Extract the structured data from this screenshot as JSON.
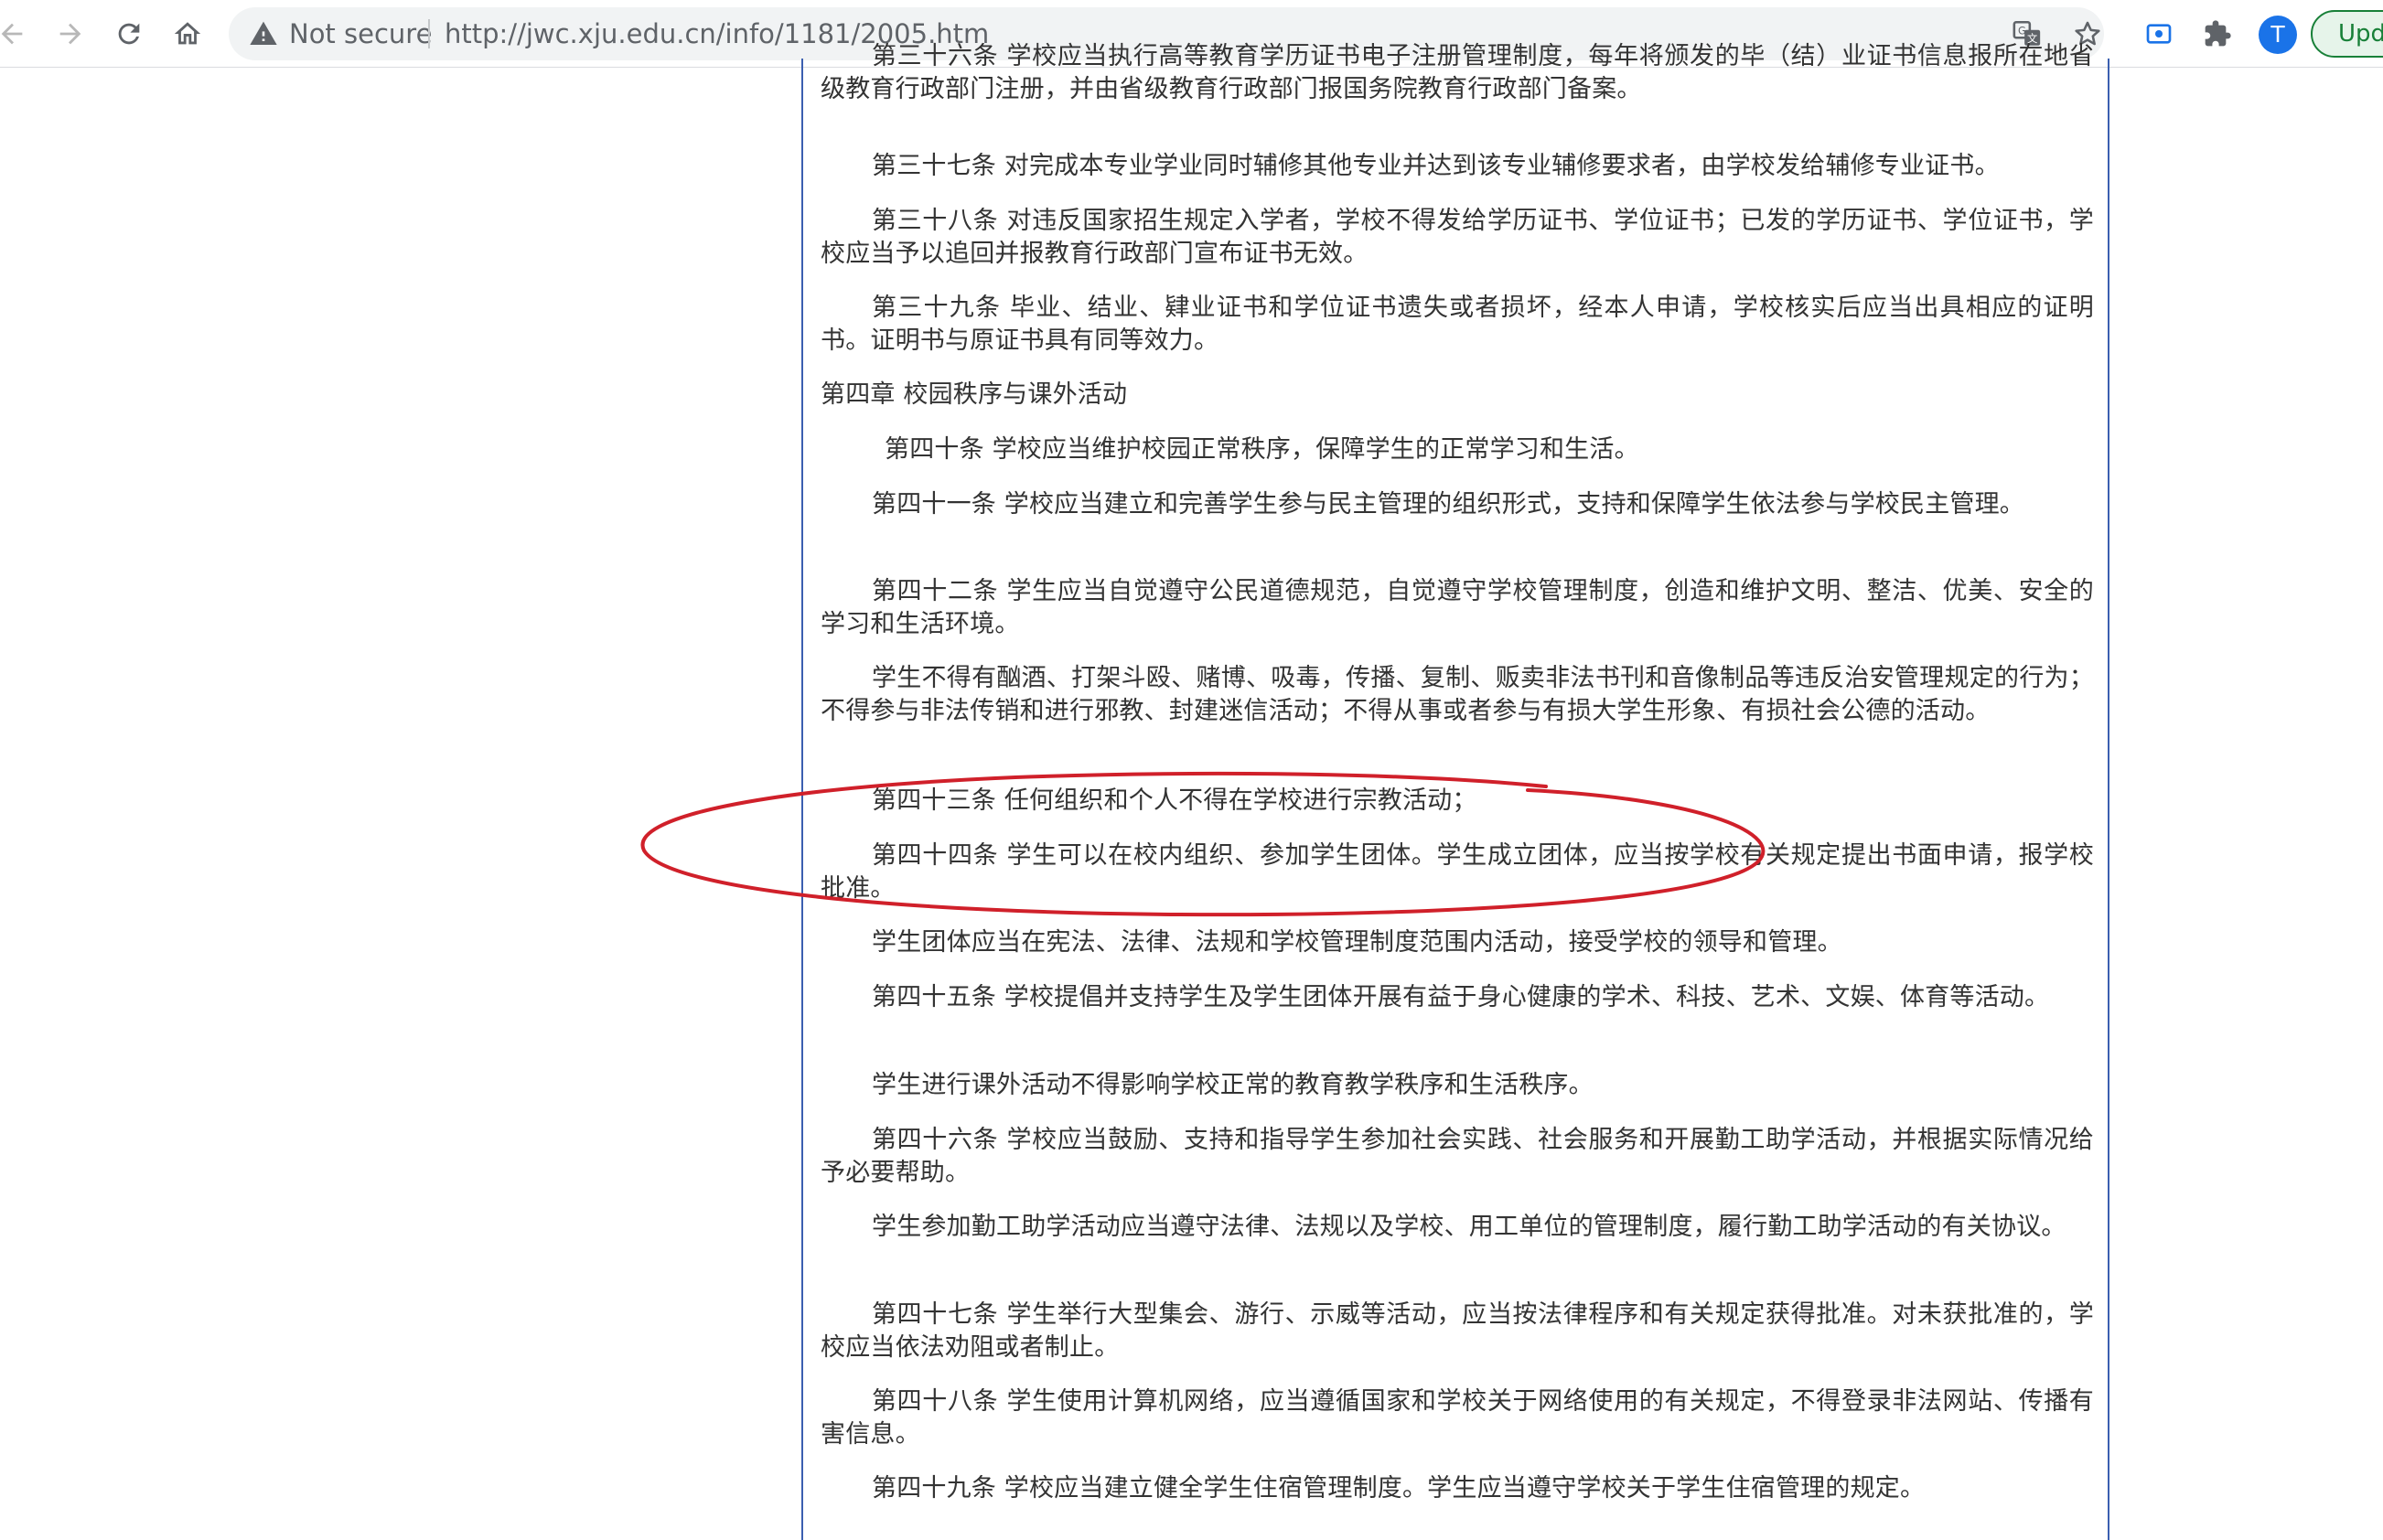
{
  "browser": {
    "security_label": "Not secure",
    "url": "http://jwc.xju.edu.cn/info/1181/2005.htm",
    "avatar_letter": "T",
    "update_label": "Upda"
  },
  "article": {
    "paragraphs": [
      "第三十六条 学校应当执行高等教育学历证书电子注册管理制度，每年将颁发的毕（结）业证书信息报所在地省级教育行政部门注册，并由省级教育行政部门报国务院教育行政部门备案。",
      "第三十七条 对完成本专业学业同时辅修其他专业并达到该专业辅修要求者，由学校发给辅修专业证书。",
      "第三十八条 对违反国家招生规定入学者，学校不得发给学历证书、学位证书；已发的学历证书、学位证书，学校应当予以追回并报教育行政部门宣布证书无效。",
      "第三十九条 毕业、结业、肄业证书和学位证书遗失或者损坏，经本人申请，学校核实后应当出具相应的证明书。证明书与原证书具有同等效力。",
      "第四章 校园秩序与课外活动",
      "第四十条 学校应当维护校园正常秩序，保障学生的正常学习和生活。",
      "第四十一条 学校应当建立和完善学生参与民主管理的组织形式，支持和保障学生依法参与学校民主管理。",
      "第四十二条 学生应当自觉遵守公民道德规范，自觉遵守学校管理制度，创造和维护文明、整洁、优美、安全的学习和生活环境。",
      "学生不得有酗酒、打架斗殴、赌博、吸毒，传播、复制、贩卖非法书刊和音像制品等违反治安管理规定的行为；不得参与非法传销和进行邪教、封建迷信活动；不得从事或者参与有损大学生形象、有损社会公德的活动。",
      "第四十三条 任何组织和个人不得在学校进行宗教活动；",
      "第四十四条 学生可以在校内组织、参加学生团体。学生成立团体，应当按学校有关规定提出书面申请，报学校批准。",
      "学生团体应当在宪法、法律、法规和学校管理制度范围内活动，接受学校的领导和管理。",
      "第四十五条 学校提倡并支持学生及学生团体开展有益于身心健康的学术、科技、艺术、文娱、体育等活动。",
      "学生进行课外活动不得影响学校正常的教育教学秩序和生活秩序。",
      "第四十六条 学校应当鼓励、支持和指导学生参加社会实践、社会服务和开展勤工助学活动，并根据实际情况给予必要帮助。",
      "学生参加勤工助学活动应当遵守法律、法规以及学校、用工单位的管理制度，履行勤工助学活动的有关协议。",
      "第四十七条 学生举行大型集会、游行、示威等活动，应当按法律程序和有关规定获得批准。对未获批准的，学校应当依法劝阻或者制止。",
      "第四十八条 学生使用计算机网络，应当遵循国家和学校关于网络使用的有关规定，不得登录非法网站、传播有害信息。",
      "第四十九条 学校应当建立健全学生住宿管理制度。学生应当遵守学校关于学生住宿管理的规定。"
    ]
  },
  "annotation": {
    "color": "#d0202a"
  }
}
